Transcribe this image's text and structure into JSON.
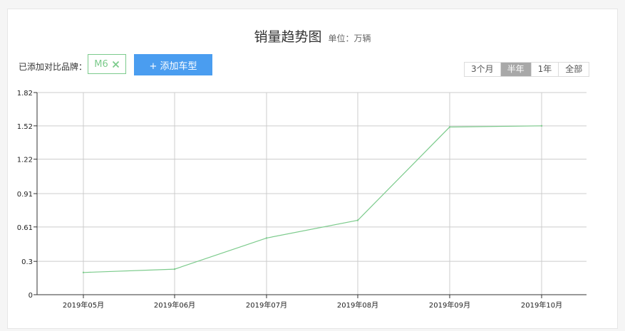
{
  "header": {
    "title": "销量趋势图",
    "unit": "单位：万辆"
  },
  "controls": {
    "brand_label": "已添加对比品牌：",
    "brand_tag": "M6",
    "add_button": "+ 添加车型",
    "ranges": [
      "3个月",
      "半年",
      "1年",
      "全部"
    ],
    "active_range": "半年"
  },
  "colors": {
    "line": "#7ccb8c",
    "accent": "#4a9df0",
    "active_range_bg": "#a8a8a8"
  },
  "chart_data": {
    "type": "line",
    "title": "销量趋势图",
    "xlabel": "",
    "ylabel": "",
    "categories": [
      "2019年05月",
      "2019年06月",
      "2019年07月",
      "2019年08月",
      "2019年09月",
      "2019年10月"
    ],
    "series": [
      {
        "name": "M6",
        "values": [
          0.2,
          0.23,
          0.51,
          0.67,
          1.51,
          1.52
        ]
      }
    ],
    "yticks": [
      "0",
      "0.3",
      "0.61",
      "0.91",
      "1.22",
      "1.52",
      "1.82"
    ],
    "ylim": [
      0,
      1.82
    ],
    "grid": true,
    "legend": "none"
  }
}
